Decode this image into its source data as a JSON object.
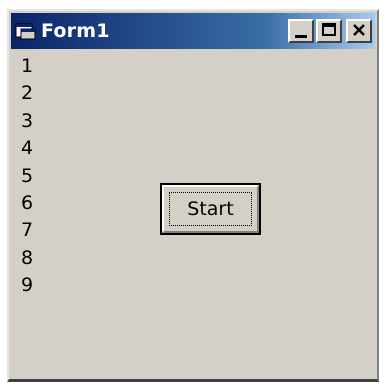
{
  "window": {
    "title": "Form1",
    "titlebar_colors": {
      "start": "#0a246a",
      "end": "#a6caf0"
    },
    "face_color": "#d4d0c8"
  },
  "icons": {
    "app": "form-window-icon",
    "minimize": "minimize-icon",
    "maximize": "maximize-icon",
    "close": "close-icon"
  },
  "numbers": [
    "1",
    "2",
    "3",
    "4",
    "5",
    "6",
    "7",
    "8",
    "9"
  ],
  "start_button": {
    "label": "Start"
  }
}
